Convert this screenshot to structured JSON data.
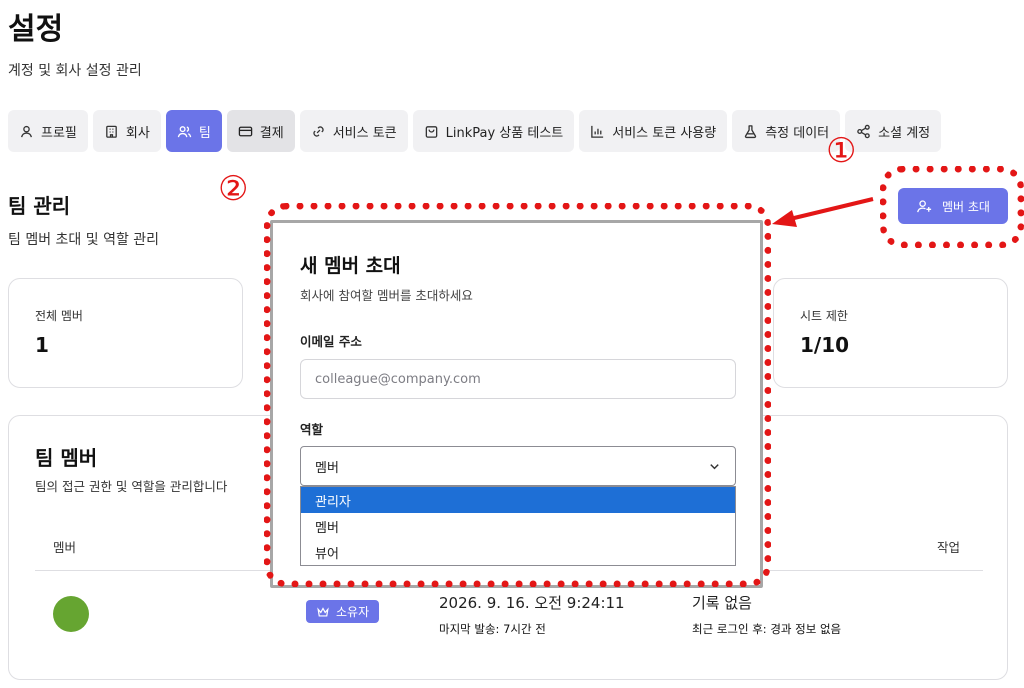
{
  "page": {
    "title": "설정",
    "subtitle": "계정 및 회사 설정 관리"
  },
  "tabs": [
    {
      "label": "프로필",
      "icon": "user-icon",
      "active": false
    },
    {
      "label": "회사",
      "icon": "building-icon",
      "active": false
    },
    {
      "label": "팀",
      "icon": "users-icon",
      "active": true
    },
    {
      "label": "결제",
      "icon": "credit-card-icon",
      "active": false
    },
    {
      "label": "서비스 토큰",
      "icon": "link-icon",
      "active": false
    },
    {
      "label": "LinkPay 상품 테스트",
      "icon": "shopping-bag-icon",
      "active": false
    },
    {
      "label": "서비스 토큰 사용량",
      "icon": "bar-chart-icon",
      "active": false
    },
    {
      "label": "측정 데이터",
      "icon": "flask-icon",
      "active": false
    },
    {
      "label": "소셜 계정",
      "icon": "share-icon",
      "active": false
    }
  ],
  "team": {
    "title": "팀 관리",
    "subtitle": "팀 멤버 초대 및 역할 관리",
    "invite_button": "멤버 초대"
  },
  "stats": {
    "total_label": "전체 멤버",
    "total_value": "1",
    "seat_label": "시트 제한",
    "seat_value": "1/10"
  },
  "members": {
    "title": "팀 멤버",
    "subtitle": "팀의 접근 권한 및 역할을 관리합니다",
    "columns": {
      "member": "멤버",
      "action": "작업"
    },
    "rows": [
      {
        "avatar_color": "#66a531",
        "role": "소유자",
        "sent_date": "2026. 9. 16. 오전 9:24:11",
        "sent_sub": "마지막 발송: 7시간 전",
        "login_main": "기록 없음",
        "login_sub": "최근 로그인 후: 경과 정보 없음"
      }
    ]
  },
  "modal": {
    "title": "새 멤버 초대",
    "subtitle": "회사에 참여할 멤버를 초대하세요",
    "email_label": "이메일 주소",
    "email_placeholder": "colleague@company.com",
    "role_label": "역할",
    "role_selected": "멤버",
    "role_options": [
      "관리자",
      "멤버",
      "뷰어"
    ],
    "highlighted_option": "관리자"
  },
  "annotations": {
    "step1": "①",
    "step2": "②",
    "color": "#e31616"
  },
  "colors": {
    "accent": "#6b74e8",
    "selected_option": "#1e6fd6"
  }
}
